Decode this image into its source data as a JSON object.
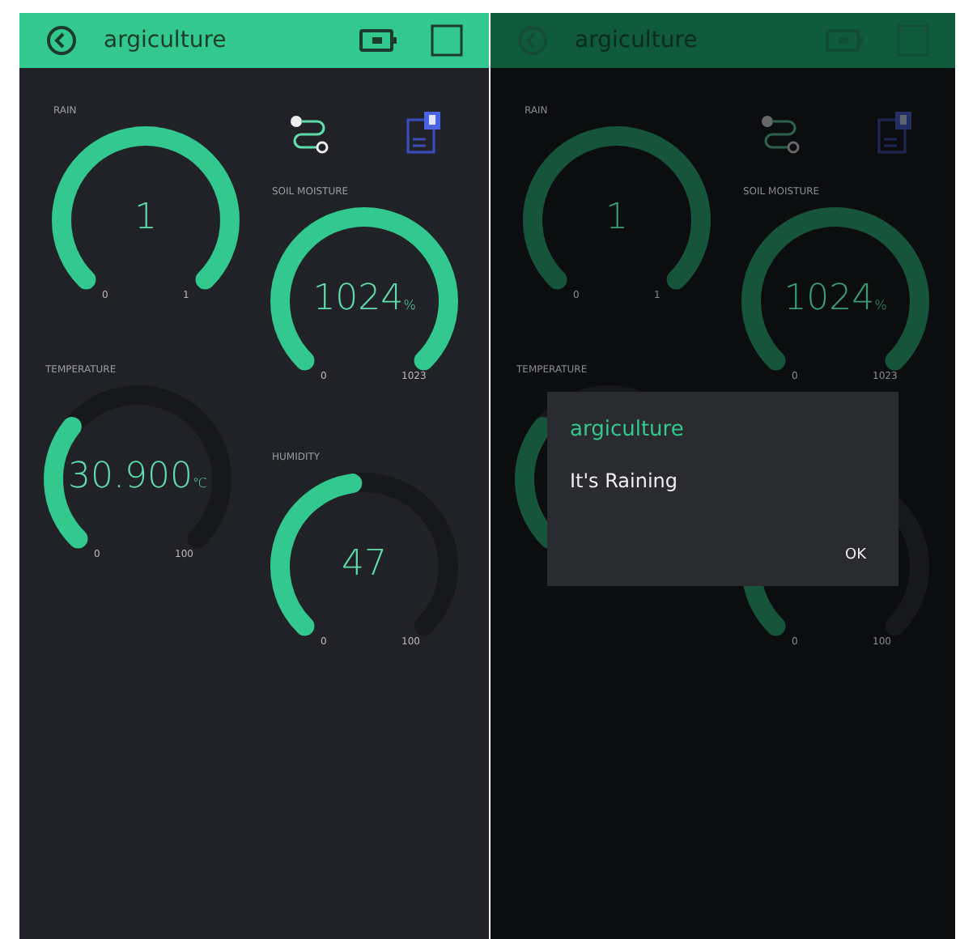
{
  "screens": [
    {
      "title": "argiculture",
      "dimmed": false,
      "widgets": [
        {
          "kind": "gauge",
          "label": "RAIN",
          "value": "1",
          "min": "0",
          "max": "1"
        },
        {
          "kind": "gauge",
          "label": "SOIL MOISTURE",
          "value": "1024",
          "unit": "%",
          "min": "0",
          "max": "1023"
        },
        {
          "kind": "gauge",
          "label": "TEMPERATURE",
          "value": "30.900",
          "unit": "℃",
          "min": "0",
          "max": "100"
        },
        {
          "kind": "gauge",
          "label": "HUMIDITY",
          "value": "47",
          "min": "0",
          "max": "100"
        }
      ]
    },
    {
      "title": "argiculture",
      "dimmed": true,
      "widgets": [
        {
          "kind": "gauge",
          "label": "RAIN",
          "value": "1",
          "min": "0",
          "max": "1"
        },
        {
          "kind": "gauge",
          "label": "SOIL MOISTURE",
          "value": "1024",
          "unit": "%",
          "min": "0",
          "max": "1023"
        },
        {
          "kind": "gauge",
          "label": "TEMPERATURE"
        },
        {
          "kind": "gauge",
          "min": "0",
          "max": "100"
        }
      ],
      "dialog": {
        "title": "argiculture",
        "message": "It's Raining",
        "button": "OK"
      }
    }
  ]
}
